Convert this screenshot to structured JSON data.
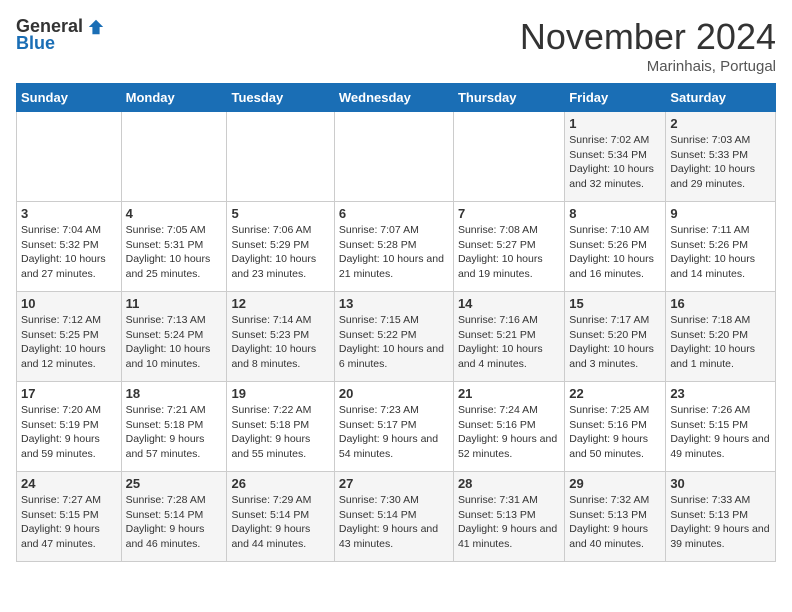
{
  "logo": {
    "general": "General",
    "blue": "Blue"
  },
  "title": "November 2024",
  "subtitle": "Marinhais, Portugal",
  "days_of_week": [
    "Sunday",
    "Monday",
    "Tuesday",
    "Wednesday",
    "Thursday",
    "Friday",
    "Saturday"
  ],
  "weeks": [
    [
      {
        "day": "",
        "info": ""
      },
      {
        "day": "",
        "info": ""
      },
      {
        "day": "",
        "info": ""
      },
      {
        "day": "",
        "info": ""
      },
      {
        "day": "",
        "info": ""
      },
      {
        "day": "1",
        "info": "Sunrise: 7:02 AM\nSunset: 5:34 PM\nDaylight: 10 hours and 32 minutes."
      },
      {
        "day": "2",
        "info": "Sunrise: 7:03 AM\nSunset: 5:33 PM\nDaylight: 10 hours and 29 minutes."
      }
    ],
    [
      {
        "day": "3",
        "info": "Sunrise: 7:04 AM\nSunset: 5:32 PM\nDaylight: 10 hours and 27 minutes."
      },
      {
        "day": "4",
        "info": "Sunrise: 7:05 AM\nSunset: 5:31 PM\nDaylight: 10 hours and 25 minutes."
      },
      {
        "day": "5",
        "info": "Sunrise: 7:06 AM\nSunset: 5:29 PM\nDaylight: 10 hours and 23 minutes."
      },
      {
        "day": "6",
        "info": "Sunrise: 7:07 AM\nSunset: 5:28 PM\nDaylight: 10 hours and 21 minutes."
      },
      {
        "day": "7",
        "info": "Sunrise: 7:08 AM\nSunset: 5:27 PM\nDaylight: 10 hours and 19 minutes."
      },
      {
        "day": "8",
        "info": "Sunrise: 7:10 AM\nSunset: 5:26 PM\nDaylight: 10 hours and 16 minutes."
      },
      {
        "day": "9",
        "info": "Sunrise: 7:11 AM\nSunset: 5:26 PM\nDaylight: 10 hours and 14 minutes."
      }
    ],
    [
      {
        "day": "10",
        "info": "Sunrise: 7:12 AM\nSunset: 5:25 PM\nDaylight: 10 hours and 12 minutes."
      },
      {
        "day": "11",
        "info": "Sunrise: 7:13 AM\nSunset: 5:24 PM\nDaylight: 10 hours and 10 minutes."
      },
      {
        "day": "12",
        "info": "Sunrise: 7:14 AM\nSunset: 5:23 PM\nDaylight: 10 hours and 8 minutes."
      },
      {
        "day": "13",
        "info": "Sunrise: 7:15 AM\nSunset: 5:22 PM\nDaylight: 10 hours and 6 minutes."
      },
      {
        "day": "14",
        "info": "Sunrise: 7:16 AM\nSunset: 5:21 PM\nDaylight: 10 hours and 4 minutes."
      },
      {
        "day": "15",
        "info": "Sunrise: 7:17 AM\nSunset: 5:20 PM\nDaylight: 10 hours and 3 minutes."
      },
      {
        "day": "16",
        "info": "Sunrise: 7:18 AM\nSunset: 5:20 PM\nDaylight: 10 hours and 1 minute."
      }
    ],
    [
      {
        "day": "17",
        "info": "Sunrise: 7:20 AM\nSunset: 5:19 PM\nDaylight: 9 hours and 59 minutes."
      },
      {
        "day": "18",
        "info": "Sunrise: 7:21 AM\nSunset: 5:18 PM\nDaylight: 9 hours and 57 minutes."
      },
      {
        "day": "19",
        "info": "Sunrise: 7:22 AM\nSunset: 5:18 PM\nDaylight: 9 hours and 55 minutes."
      },
      {
        "day": "20",
        "info": "Sunrise: 7:23 AM\nSunset: 5:17 PM\nDaylight: 9 hours and 54 minutes."
      },
      {
        "day": "21",
        "info": "Sunrise: 7:24 AM\nSunset: 5:16 PM\nDaylight: 9 hours and 52 minutes."
      },
      {
        "day": "22",
        "info": "Sunrise: 7:25 AM\nSunset: 5:16 PM\nDaylight: 9 hours and 50 minutes."
      },
      {
        "day": "23",
        "info": "Sunrise: 7:26 AM\nSunset: 5:15 PM\nDaylight: 9 hours and 49 minutes."
      }
    ],
    [
      {
        "day": "24",
        "info": "Sunrise: 7:27 AM\nSunset: 5:15 PM\nDaylight: 9 hours and 47 minutes."
      },
      {
        "day": "25",
        "info": "Sunrise: 7:28 AM\nSunset: 5:14 PM\nDaylight: 9 hours and 46 minutes."
      },
      {
        "day": "26",
        "info": "Sunrise: 7:29 AM\nSunset: 5:14 PM\nDaylight: 9 hours and 44 minutes."
      },
      {
        "day": "27",
        "info": "Sunrise: 7:30 AM\nSunset: 5:14 PM\nDaylight: 9 hours and 43 minutes."
      },
      {
        "day": "28",
        "info": "Sunrise: 7:31 AM\nSunset: 5:13 PM\nDaylight: 9 hours and 41 minutes."
      },
      {
        "day": "29",
        "info": "Sunrise: 7:32 AM\nSunset: 5:13 PM\nDaylight: 9 hours and 40 minutes."
      },
      {
        "day": "30",
        "info": "Sunrise: 7:33 AM\nSunset: 5:13 PM\nDaylight: 9 hours and 39 minutes."
      }
    ]
  ]
}
